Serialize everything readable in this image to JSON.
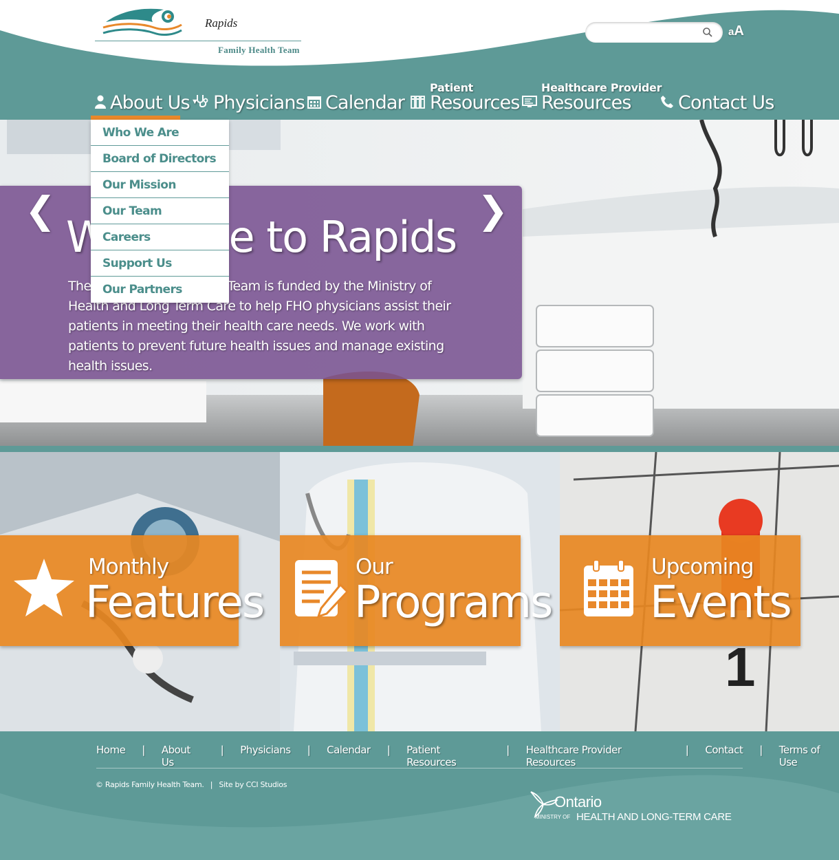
{
  "header": {
    "logo": {
      "name": "Rapids",
      "subtitle": "Family Health Team"
    },
    "search": {
      "placeholder": "",
      "icon": "search-icon"
    },
    "font_size_toggle": {
      "small": "a",
      "large": "A"
    }
  },
  "nav": [
    {
      "label": "About Us",
      "icon": "person-icon",
      "active": true,
      "has_dropdown": true
    },
    {
      "label": "Physicians",
      "icon": "stethoscope-icon"
    },
    {
      "label": "Calendar",
      "icon": "calendar-icon"
    },
    {
      "small": "Patient",
      "label": "Resources",
      "icon": "books-icon"
    },
    {
      "small": "Healthcare Provider",
      "label": "Resources",
      "icon": "monitor-icon"
    },
    {
      "label": "Contact Us",
      "icon": "phone-icon"
    }
  ],
  "dropdown": [
    "Who We Are",
    "Board of Directors",
    "Our Mission",
    "Our Team",
    "Careers",
    "Support Us",
    "Our Partners"
  ],
  "hero": {
    "title": "Welcome to Rapids",
    "text": "The Rapids Family Health Team is funded by the Ministry of Health and Long Term Care to help FHO physicians assist their patients in meeting their health care needs. We work with patients to prevent future health issues and manage existing health issues.",
    "prev": "❮",
    "next": "❯"
  },
  "tiles": [
    {
      "small": "Monthly",
      "big": "Features",
      "icon": "star-icon"
    },
    {
      "small": "Our",
      "big": "Programs",
      "icon": "document-icon"
    },
    {
      "small": "Upcoming",
      "big": "Events",
      "icon": "calendar-icon"
    }
  ],
  "footer": {
    "links": [
      "Home",
      "About Us",
      "Physicians",
      "Calendar",
      "Patient Resources",
      "Healthcare Provider Resources",
      "Contact",
      "Terms of Use"
    ],
    "separator": "|",
    "copyright": "© Rapids Family Health Team.",
    "credit": "Site by CCI Studios",
    "ontario": {
      "name": "Ontario",
      "ministry_prefix": "MINISTRY OF",
      "ministry": "HEALTH AND LONG-TERM CARE"
    }
  },
  "colors": {
    "teal": "#5e9a97",
    "orange": "#e8882a",
    "purple": "#795291",
    "dropdown_text": "#4b8e8b"
  }
}
